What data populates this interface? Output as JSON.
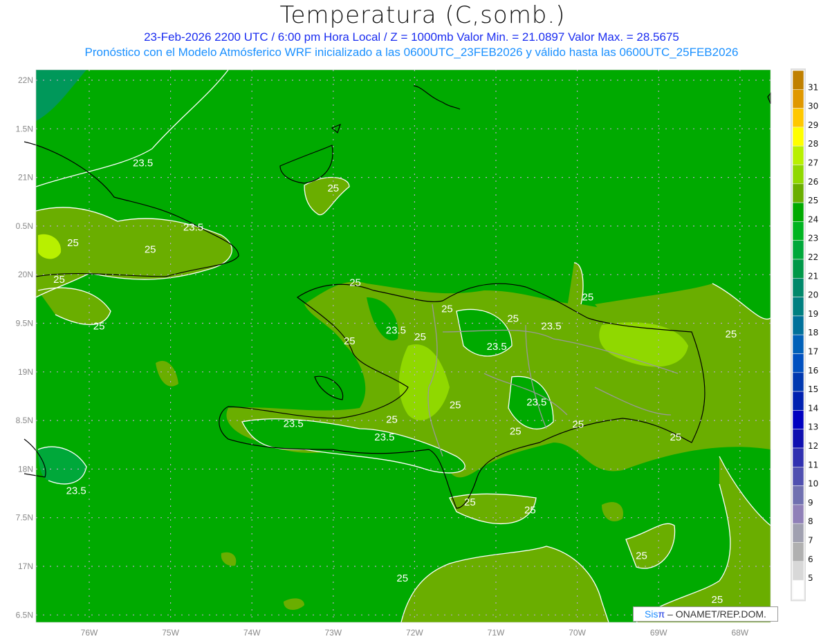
{
  "title": "Temperatura (C,somb.)",
  "subtitle_line1": "23-Feb-2026  2200 UTC / 6:00 pm Hora Local / Z = 1000mb    Valor Min. = 21.0897  Valor Max. = 28.5675",
  "subtitle_line2": "Pronóstico con el Modelo Atmósferico WRF inicializado a las 0600UTC_23FEB2026 y válido hasta las  0600UTC_25FEB2026",
  "map": {
    "lon_range": [
      -76.66,
      -67.62
    ],
    "lat_range": [
      16.4,
      22.1
    ],
    "lon_ticks": [
      {
        "v": -76,
        "label": "76W"
      },
      {
        "v": -75,
        "label": "75W"
      },
      {
        "v": -74,
        "label": "74W"
      },
      {
        "v": -73,
        "label": "73W"
      },
      {
        "v": -72,
        "label": "72W"
      },
      {
        "v": -71,
        "label": "71W"
      },
      {
        "v": -70,
        "label": "70W"
      },
      {
        "v": -69,
        "label": "69W"
      },
      {
        "v": -68,
        "label": "68W"
      }
    ],
    "lat_ticks": [
      {
        "v": 22,
        "label": "22N"
      },
      {
        "v": 21.5,
        "label": "1.5N"
      },
      {
        "v": 21,
        "label": "21N"
      },
      {
        "v": 20.5,
        "label": "0.5N"
      },
      {
        "v": 20,
        "label": "20N"
      },
      {
        "v": 19.5,
        "label": "9.5N"
      },
      {
        "v": 19,
        "label": "19N"
      },
      {
        "v": 18.5,
        "label": "8.5N"
      },
      {
        "v": 18,
        "label": "18N"
      },
      {
        "v": 17.5,
        "label": "7.5N"
      },
      {
        "v": 17,
        "label": "17N"
      },
      {
        "v": 16.5,
        "label": "6.5N"
      }
    ],
    "grid": true,
    "background_color": "#00aa00",
    "warm_color": "#6aae00",
    "warmer_color": "#90d800",
    "contour_labels": [
      {
        "t": "23.5",
        "lon": -75.34,
        "lat": 21.15
      },
      {
        "t": "25",
        "lon": -73.0,
        "lat": 20.89
      },
      {
        "t": "23.5",
        "lon": -74.72,
        "lat": 20.49
      },
      {
        "t": "25",
        "lon": -76.2,
        "lat": 20.33
      },
      {
        "t": "25",
        "lon": -75.25,
        "lat": 20.26
      },
      {
        "t": "25",
        "lon": -76.37,
        "lat": 19.95
      },
      {
        "t": "25",
        "lon": -75.88,
        "lat": 19.47
      },
      {
        "t": "25",
        "lon": -72.73,
        "lat": 19.92
      },
      {
        "t": "25",
        "lon": -71.6,
        "lat": 19.65
      },
      {
        "t": "25",
        "lon": -69.87,
        "lat": 19.77
      },
      {
        "t": "23.5",
        "lon": -72.23,
        "lat": 19.43
      },
      {
        "t": "25",
        "lon": -72.8,
        "lat": 19.32
      },
      {
        "t": "25",
        "lon": -70.79,
        "lat": 19.55
      },
      {
        "t": "23.5",
        "lon": -70.32,
        "lat": 19.47
      },
      {
        "t": "23.5",
        "lon": -70.99,
        "lat": 19.26
      },
      {
        "t": "25",
        "lon": -68.11,
        "lat": 19.39
      },
      {
        "t": "25",
        "lon": -71.93,
        "lat": 19.36
      },
      {
        "t": "25",
        "lon": -71.5,
        "lat": 18.66
      },
      {
        "t": "23.5",
        "lon": -70.5,
        "lat": 18.69
      },
      {
        "t": "23.5",
        "lon": -73.49,
        "lat": 18.47
      },
      {
        "t": "25",
        "lon": -72.28,
        "lat": 18.51
      },
      {
        "t": "25",
        "lon": -70.76,
        "lat": 18.39
      },
      {
        "t": "25",
        "lon": -69.99,
        "lat": 18.46
      },
      {
        "t": "25",
        "lon": -68.79,
        "lat": 18.33
      },
      {
        "t": "23.5",
        "lon": -72.37,
        "lat": 18.33
      },
      {
        "t": "23.5",
        "lon": -76.16,
        "lat": 17.78
      },
      {
        "t": "25",
        "lon": -71.32,
        "lat": 17.66
      },
      {
        "t": "25",
        "lon": -70.58,
        "lat": 17.58
      },
      {
        "t": "25",
        "lon": -69.21,
        "lat": 17.11
      },
      {
        "t": "25",
        "lon": -72.15,
        "lat": 16.88
      },
      {
        "t": "25",
        "lon": -68.28,
        "lat": 16.66
      }
    ]
  },
  "colorbar": {
    "labels": [
      "31",
      "30",
      "29",
      "28",
      "27",
      "26",
      "25",
      "24",
      "23",
      "22",
      "21",
      "20",
      "19",
      "18",
      "17",
      "16",
      "15",
      "14",
      "13",
      "12",
      "11",
      "10",
      "9",
      "8",
      "7",
      "6",
      "5"
    ],
    "colors": [
      "#c08000",
      "#e09800",
      "#ffc800",
      "#ffff00",
      "#b8f000",
      "#90d800",
      "#6aae00",
      "#00aa00",
      "#00b420",
      "#00a83a",
      "#009848",
      "#00886a",
      "#007f80",
      "#00709a",
      "#0060b8",
      "#0050c0",
      "#0038b0",
      "#0020b0",
      "#0000c0",
      "#1010b0",
      "#3030b0",
      "#5050b0",
      "#7070b0",
      "#9080b8",
      "#a0a0b0",
      "#b0b0b0",
      "#d8d8d8",
      "#ffffff"
    ]
  },
  "credit": {
    "sis": "Sis",
    "pi": "π",
    "rest": " – ONAMET/REP.DOM."
  }
}
